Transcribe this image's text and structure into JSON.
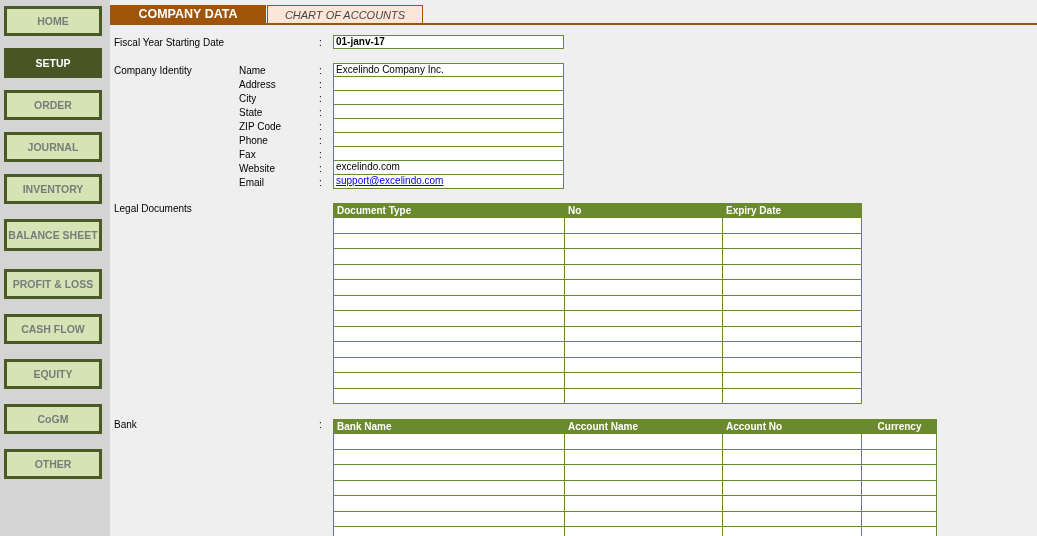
{
  "sidebar": {
    "items": [
      {
        "label": "HOME",
        "selected": false
      },
      {
        "label": "SETUP",
        "selected": true
      },
      {
        "label": "ORDER",
        "selected": false
      },
      {
        "label": "JOURNAL",
        "selected": false
      },
      {
        "label": "INVENTORY",
        "selected": false
      },
      {
        "label": "BALANCE SHEET",
        "selected": false
      },
      {
        "label": "PROFIT & LOSS",
        "selected": false
      },
      {
        "label": "CASH FLOW",
        "selected": false
      },
      {
        "label": "EQUITY",
        "selected": false
      },
      {
        "label": "CoGM",
        "selected": false
      },
      {
        "label": "OTHER",
        "selected": false
      }
    ]
  },
  "tabs": [
    {
      "label": "COMPANY DATA",
      "selected": true
    },
    {
      "label": "CHART OF ACCOUNTS",
      "selected": false
    }
  ],
  "fiscal_year": {
    "label": "Fiscal Year Starting Date",
    "separator": ":",
    "value": "01-janv-17"
  },
  "company_identity": {
    "label": "Company Identity",
    "fields": [
      {
        "label": "Name",
        "separator": ":",
        "value": "Excelindo Company Inc.",
        "kind": "text"
      },
      {
        "label": "Address",
        "separator": ":",
        "kind": "text"
      },
      {
        "label": "City",
        "separator": ":",
        "kind": "text"
      },
      {
        "label": "State",
        "separator": ":",
        "kind": "text"
      },
      {
        "label": "ZIP Code",
        "separator": ":",
        "kind": "text"
      },
      {
        "label": "Phone",
        "separator": ":",
        "kind": "text"
      },
      {
        "label": "Fax",
        "separator": ":",
        "kind": "text"
      },
      {
        "label": "Website",
        "separator": ":",
        "value": "excelindo.com",
        "kind": "text"
      },
      {
        "label": "Email",
        "separator": ":",
        "value": "support@excelindo.com",
        "kind": "link"
      }
    ]
  },
  "legal_documents": {
    "label": "Legal Documents",
    "columns": [
      "Document Type",
      "No",
      "Expiry Date"
    ]
  },
  "bank": {
    "label": "Bank",
    "separator": ":",
    "columns": [
      "Bank Name",
      "Account Name",
      "Account No",
      "Currency"
    ]
  }
}
